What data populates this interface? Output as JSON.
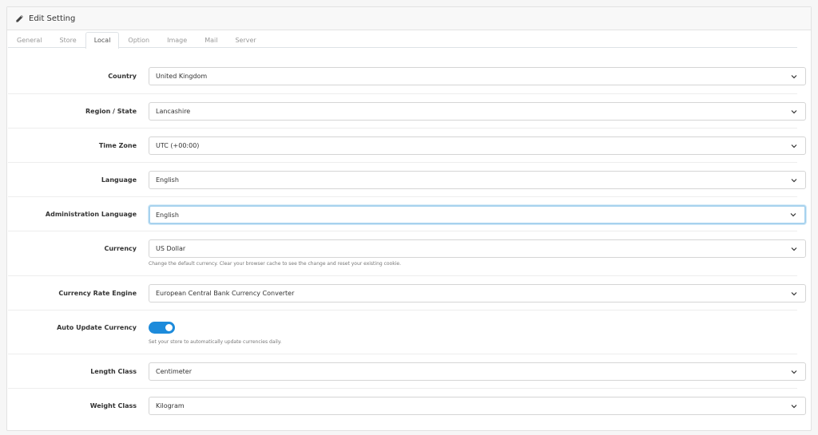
{
  "header": {
    "title": "Edit Setting"
  },
  "tabs": [
    {
      "label": "General"
    },
    {
      "label": "Store"
    },
    {
      "label": "Local",
      "active": true
    },
    {
      "label": "Option"
    },
    {
      "label": "Image"
    },
    {
      "label": "Mail"
    },
    {
      "label": "Server"
    }
  ],
  "fields": {
    "country": {
      "label": "Country",
      "value": "United Kingdom"
    },
    "region": {
      "label": "Region / State",
      "value": "Lancashire"
    },
    "timezone": {
      "label": "Time Zone",
      "value": "UTC (+00:00)"
    },
    "language": {
      "label": "Language",
      "value": "English"
    },
    "admin_language": {
      "label": "Administration Language",
      "value": "English"
    },
    "currency": {
      "label": "Currency",
      "value": "US Dollar",
      "help": "Change the default currency. Clear your browser cache to see the change and reset your existing cookie."
    },
    "currency_engine": {
      "label": "Currency Rate Engine",
      "value": "European Central Bank Currency Converter"
    },
    "auto_update": {
      "label": "Auto Update Currency",
      "enabled": true,
      "help": "Set your store to automatically update currencies daily."
    },
    "length_class": {
      "label": "Length Class",
      "value": "Centimeter"
    },
    "weight_class": {
      "label": "Weight Class",
      "value": "Kilogram"
    }
  },
  "colors": {
    "accent": "#1d8bdb",
    "focus": "#a7d2ee"
  },
  "icons": {
    "header": "pencil-icon",
    "select": "chevron-down-icon"
  }
}
